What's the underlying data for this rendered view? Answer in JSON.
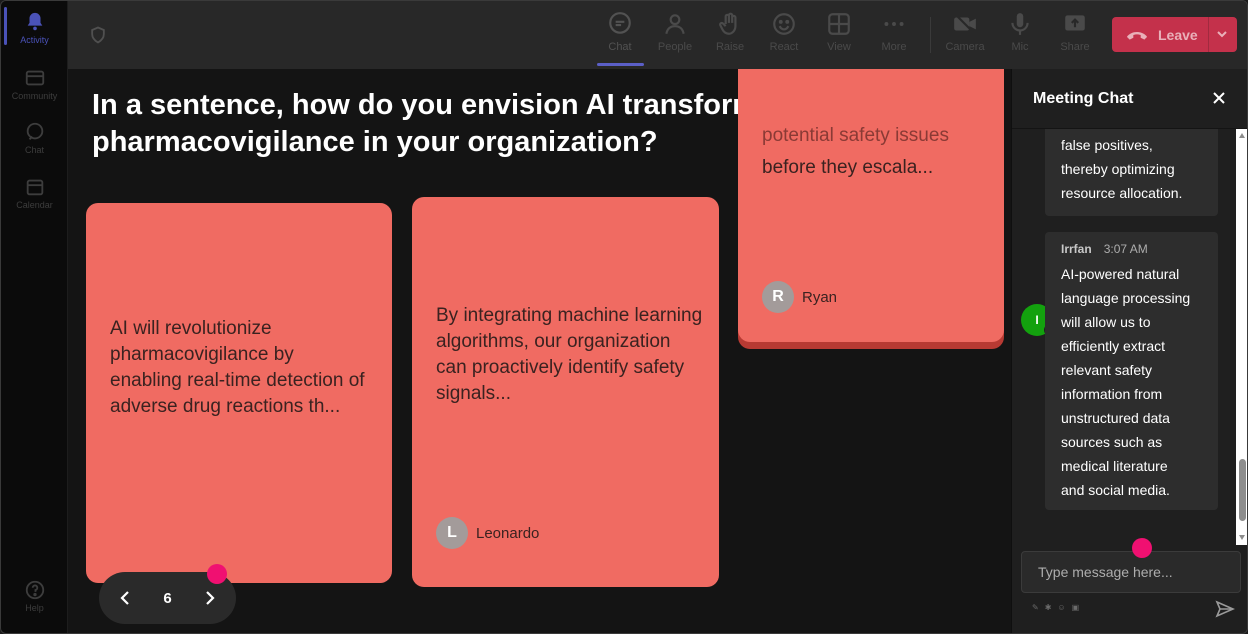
{
  "rail": {
    "items": [
      {
        "label": "Activity",
        "icon": "bell-icon",
        "active": true
      },
      {
        "label": "Community",
        "icon": "community-icon",
        "active": false
      },
      {
        "label": "Chat",
        "icon": "chat-icon",
        "active": false
      },
      {
        "label": "Calendar",
        "icon": "calendar-icon",
        "active": false
      },
      {
        "label": "Help",
        "icon": "help-icon",
        "active": false
      }
    ]
  },
  "toolbar": {
    "chat": "Chat",
    "people": "People",
    "raise": "Raise",
    "react": "React",
    "view": "View",
    "more": "More",
    "camera": "Camera",
    "mic": "Mic",
    "share": "Share",
    "leave": "Leave",
    "leave_color": "#c4314b"
  },
  "stage": {
    "question": "In a sentence, how do you envision AI transforming the future of pharmacovigilance in your organization?",
    "cards": [
      {
        "text": "AI will revolutionize pharmacovigilance by enabling real-time detection of adverse drug reactions th...",
        "author": "",
        "initial": ""
      },
      {
        "text": "By integrating machine learning algorithms, our organization can proactively identify safety signals...",
        "author": "Leonardo",
        "initial": "L"
      },
      {
        "text_partial": "potential safety issues",
        "text": "before they escala...",
        "author": "Ryan",
        "initial": "R"
      }
    ],
    "card_color": "#f06b62",
    "pager": {
      "page": "6"
    }
  },
  "chat": {
    "title": "Meeting Chat",
    "messages": [
      {
        "sender": "",
        "time": "",
        "lines": [
          "false positives,",
          "thereby optimizing",
          "resource allocation."
        ]
      },
      {
        "sender": "Irrfan",
        "time": "3:07 AM",
        "initial": "I",
        "lines": [
          "AI-powered natural",
          "language processing",
          "will allow us to",
          "efficiently extract",
          "relevant safety",
          "information from",
          "unstructured data",
          "sources such as",
          "medical literature",
          "and social media."
        ]
      }
    ],
    "compose_placeholder": "Type message here..."
  }
}
